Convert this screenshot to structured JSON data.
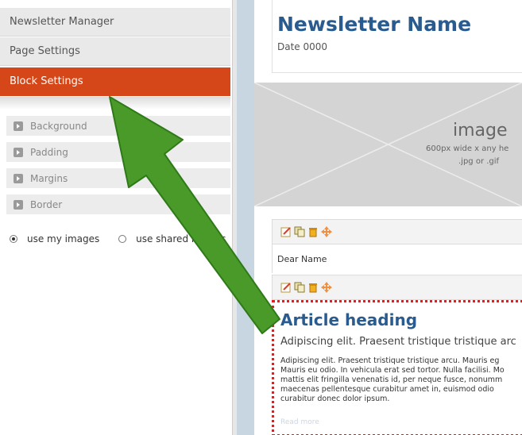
{
  "sidebar": {
    "menu": [
      {
        "label": "Newsletter Manager"
      },
      {
        "label": "Page Settings"
      },
      {
        "label": "Block Settings"
      }
    ],
    "sub_items": [
      {
        "label": "Background"
      },
      {
        "label": "Padding"
      },
      {
        "label": "Margins"
      },
      {
        "label": "Border"
      }
    ],
    "image_source": {
      "options": [
        {
          "label": "use my images",
          "checked": true
        },
        {
          "label": "use shared images",
          "checked": false
        }
      ]
    }
  },
  "preview": {
    "newsletter_name": "Newsletter Name",
    "date": "Date 0000",
    "image_placeholder": {
      "word": "image",
      "size_text": "600px wide x any he",
      "type_text": ".jpg or .gif"
    },
    "greeting": "Dear Name",
    "toolbar_icons": [
      "edit-icon",
      "copy-icon",
      "delete-icon",
      "move-icon"
    ],
    "article": {
      "heading": "Article heading",
      "subheading": "Adipiscing elit. Praesent tristique tristique arc",
      "body_lines": [
        "Adipiscing elit. Praesent tristique tristique arcu. Mauris eg",
        "Mauris eu odio. In vehicula erat sed tortor. Nulla facilisi. Mo",
        "mattis elit fringilla venenatis id, per neque fusce, nonumm",
        "maecenas pellentesque curabitur amet in, euismod odio",
        "curabitur donec dolor ipsum."
      ],
      "read_more": "Read more"
    }
  },
  "colors": {
    "accent_active": "#d54618",
    "heading_blue": "#2a5b8e",
    "arrow_green": "#4a9a2a",
    "selection_border": "#e02020"
  }
}
